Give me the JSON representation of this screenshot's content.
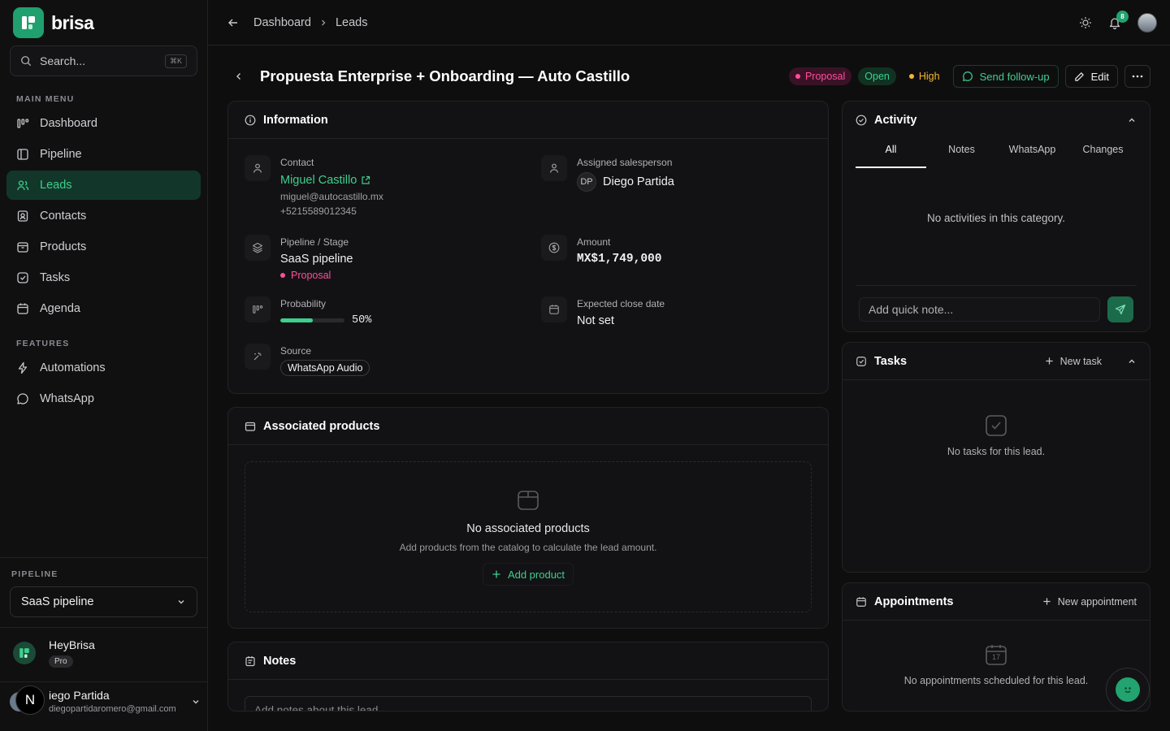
{
  "brand": {
    "name": "brisa"
  },
  "search": {
    "placeholder": "Search...",
    "shortcut": "⌘K"
  },
  "sidebar": {
    "main_menu_title": "MAIN MENU",
    "items": [
      {
        "label": "Dashboard",
        "icon": "dashboard-icon"
      },
      {
        "label": "Pipeline",
        "icon": "pipeline-icon"
      },
      {
        "label": "Leads",
        "icon": "leads-icon",
        "active": true
      },
      {
        "label": "Contacts",
        "icon": "contacts-icon"
      },
      {
        "label": "Products",
        "icon": "products-icon"
      },
      {
        "label": "Tasks",
        "icon": "tasks-icon"
      },
      {
        "label": "Agenda",
        "icon": "calendar-icon"
      }
    ],
    "features_title": "FEATURES",
    "features": [
      {
        "label": "Automations",
        "icon": "bolt-icon"
      },
      {
        "label": "WhatsApp",
        "icon": "whatsapp-icon"
      }
    ],
    "pipeline_title": "PIPELINE",
    "pipeline_value": "SaaS pipeline",
    "org": {
      "name": "HeyBrisa",
      "plan": "Pro"
    },
    "user": {
      "name": "Diego Partida",
      "name_visible": "iego Partida",
      "email": "diegopartidaromero@gmail.com",
      "badge": "N"
    }
  },
  "topbar": {
    "breadcrumb": [
      "Dashboard",
      "Leads"
    ],
    "notification_count": "8"
  },
  "lead": {
    "title": "Propuesta Enterprise + Onboarding — Auto Castillo",
    "stage_badge": "Proposal",
    "status_badge": "Open",
    "priority_badge": "High",
    "follow_up_label": "Send follow-up",
    "edit_label": "Edit",
    "colors": {
      "accent": "#3ecf8e",
      "proposal": "#ff4f9a",
      "high": "#f5b82e"
    }
  },
  "information": {
    "title": "Information",
    "contact_label": "Contact",
    "contact_name": "Miguel Castillo",
    "contact_email": "miguel@autocastillo.mx",
    "contact_phone": "+5215589012345",
    "salesperson_label": "Assigned salesperson",
    "salesperson_initials": "DP",
    "salesperson_name": "Diego Partida",
    "pipeline_label": "Pipeline / Stage",
    "pipeline_value": "SaaS pipeline",
    "stage_value": "Proposal",
    "amount_label": "Amount",
    "amount_value": "MX$1,749,000",
    "probability_label": "Probability",
    "probability_value": "50%",
    "probability_fraction": 0.5,
    "close_date_label": "Expected close date",
    "close_date_value": "Not set",
    "source_label": "Source",
    "source_value": "WhatsApp Audio"
  },
  "products": {
    "title": "Associated products",
    "empty_title": "No associated products",
    "empty_desc": "Add products from the catalog to calculate the lead amount.",
    "add_label": "Add product"
  },
  "notes": {
    "title": "Notes",
    "placeholder": "Add notes about this lead..."
  },
  "activity": {
    "title": "Activity",
    "tabs": [
      "All",
      "Notes",
      "WhatsApp",
      "Changes"
    ],
    "empty": "No activities in this category.",
    "quick_note_placeholder": "Add quick note..."
  },
  "tasks": {
    "title": "Tasks",
    "new_label": "New task",
    "empty": "No tasks for this lead."
  },
  "appointments": {
    "title": "Appointments",
    "new_label": "New appointment",
    "calendar_day": "17",
    "empty": "No appointments scheduled for this lead."
  }
}
